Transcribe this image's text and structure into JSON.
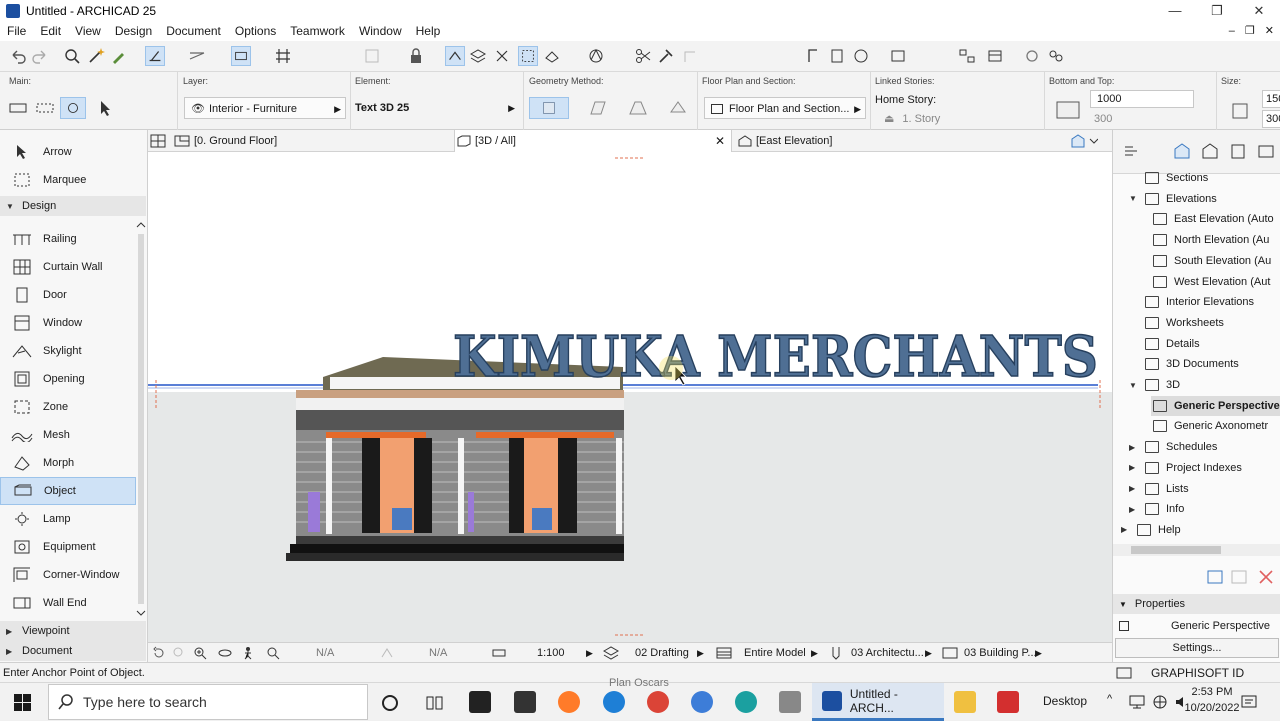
{
  "window": {
    "title": "Untitled - ARCHICAD 25",
    "minimize": "—",
    "maximize": "❐",
    "close": "✕"
  },
  "menu": {
    "items": [
      "File",
      "Edit",
      "View",
      "Design",
      "Document",
      "Options",
      "Teamwork",
      "Window",
      "Help"
    ],
    "right": [
      "–",
      "❐",
      "✕"
    ]
  },
  "infobox": {
    "main_label": "Main:",
    "layer_label": "Layer:",
    "layer_value": "Interior - Furniture",
    "element_label": "Element:",
    "element_value": "Text 3D 25",
    "geometry_label": "Geometry Method:",
    "floorplan_label": "Floor Plan and Section:",
    "floorplan_value": "Floor Plan and Section...",
    "linked_label": "Linked Stories:",
    "home_story_label": "Home Story:",
    "home_story_value": "1. Story",
    "bottomtop_label": "Bottom and Top:",
    "bottomtop_value1": "1000",
    "bottomtop_value2": "300",
    "size_label": "Size:",
    "size_value1": "150",
    "size_value2": "300"
  },
  "toolbox": {
    "top_tools": [
      {
        "label": "Arrow",
        "icon": "arrow-icon"
      },
      {
        "label": "Marquee",
        "icon": "marquee-icon"
      }
    ],
    "design_group": "Design",
    "design_tools": [
      {
        "label": "Railing",
        "icon": "railing-icon"
      },
      {
        "label": "Curtain Wall",
        "icon": "curtain-wall-icon"
      },
      {
        "label": "Door",
        "icon": "door-icon"
      },
      {
        "label": "Window",
        "icon": "window-icon"
      },
      {
        "label": "Skylight",
        "icon": "skylight-icon"
      },
      {
        "label": "Opening",
        "icon": "opening-icon"
      },
      {
        "label": "Zone",
        "icon": "zone-icon"
      },
      {
        "label": "Mesh",
        "icon": "mesh-icon"
      },
      {
        "label": "Morph",
        "icon": "morph-icon"
      },
      {
        "label": "Object",
        "icon": "object-icon",
        "selected": true
      },
      {
        "label": "Lamp",
        "icon": "lamp-icon"
      },
      {
        "label": "Equipment",
        "icon": "equipment-icon"
      },
      {
        "label": "Corner-Window",
        "icon": "corner-window-icon"
      },
      {
        "label": "Wall End",
        "icon": "wall-end-icon"
      }
    ],
    "viewpoint_group": "Viewpoint",
    "document_group": "Document"
  },
  "tabs": [
    {
      "label": "[0. Ground Floor]"
    },
    {
      "label": "[3D / All]",
      "active": true
    },
    {
      "label": "[East Elevation]"
    }
  ],
  "viewport": {
    "text3d": "KIMUKA MERCHANTS",
    "text_color": "#3a6fa8"
  },
  "view_status": {
    "na1": "N/A",
    "na2": "N/A",
    "scale": "1:100",
    "layer_combo": "02 Drafting",
    "model_view": "Entire Model",
    "pen_set": "03 Architectu...",
    "dimension": "03 Building P..."
  },
  "navigator": {
    "items": [
      {
        "label": "Sections",
        "indent": 1
      },
      {
        "label": "Elevations",
        "indent": 1,
        "expanded": true
      },
      {
        "label": "East Elevation (Auto",
        "indent": 2
      },
      {
        "label": "North Elevation (Au",
        "indent": 2
      },
      {
        "label": "South Elevation (Au",
        "indent": 2
      },
      {
        "label": "West Elevation (Aut",
        "indent": 2
      },
      {
        "label": "Interior Elevations",
        "indent": 1
      },
      {
        "label": "Worksheets",
        "indent": 1
      },
      {
        "label": "Details",
        "indent": 1
      },
      {
        "label": "3D Documents",
        "indent": 1
      },
      {
        "label": "3D",
        "indent": 1,
        "expanded": true
      },
      {
        "label": "Generic Perspective",
        "indent": 2,
        "selected": true
      },
      {
        "label": "Generic Axonometr",
        "indent": 2
      },
      {
        "label": "Schedules",
        "indent": 1
      },
      {
        "label": "Project Indexes",
        "indent": 1
      },
      {
        "label": "Lists",
        "indent": 1
      },
      {
        "label": "Info",
        "indent": 1
      },
      {
        "label": "Help",
        "indent": 0
      }
    ],
    "properties_label": "Properties",
    "properties_value": "Generic Perspective",
    "settings_label": "Settings...",
    "graphisoft": "GRAPHISOFT ID"
  },
  "statusline": {
    "hint": "Enter Anchor Point of Object."
  },
  "taskbar": {
    "search_placeholder": "Type here to search",
    "active_app": "Untitled - ARCH...",
    "desktop_label": "Desktop",
    "plan_label": "Plan Oscars",
    "time": "2:53 PM",
    "date": "10/20/2022"
  }
}
